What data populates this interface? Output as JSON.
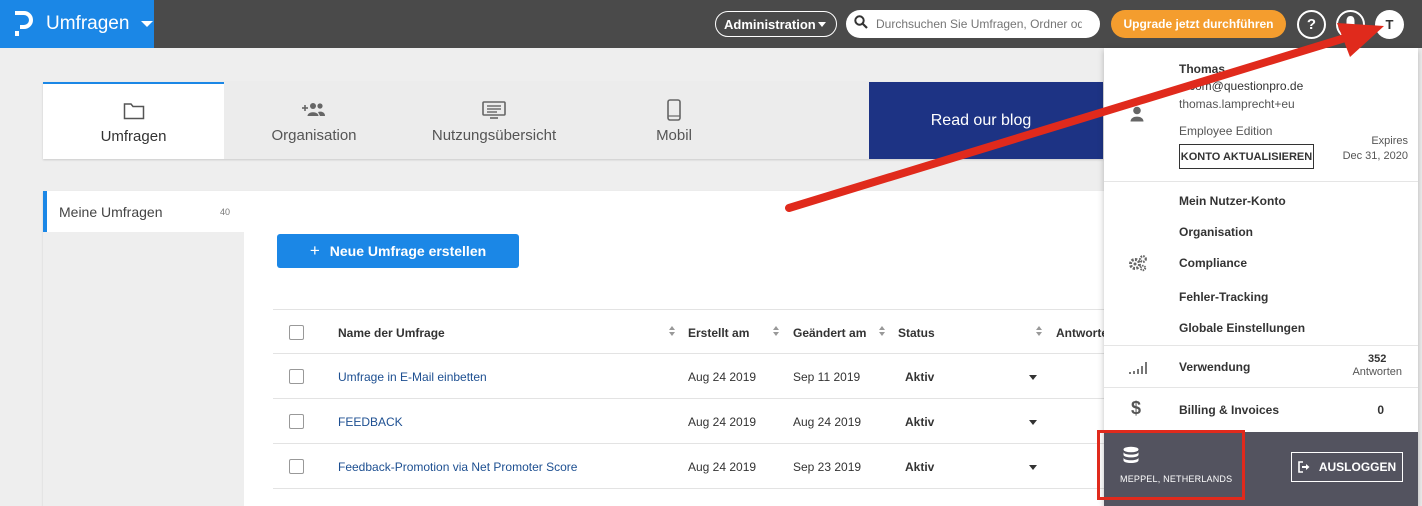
{
  "header": {
    "brand_title": "Umfragen",
    "admin_label": "Administration",
    "search_placeholder": "Durchsuchen Sie Umfragen, Ordner oder",
    "upgrade_label": "Upgrade jetzt durchführen",
    "help_label": "?",
    "avatar_initial": "T"
  },
  "tabs": [
    {
      "label": "Umfragen",
      "icon": "folder-icon"
    },
    {
      "label": "Organisation",
      "icon": "add-group-icon"
    },
    {
      "label": "Nutzungsübersicht",
      "icon": "monitor-icon"
    },
    {
      "label": "Mobil",
      "icon": "phone-icon"
    }
  ],
  "blog_label": "Read our blog",
  "folders": [
    {
      "label": "Meine Umfragen",
      "count": "40"
    }
  ],
  "new_survey_label": "Neue Umfrage erstellen",
  "table": {
    "headers": {
      "name": "Name der Umfrage",
      "created": "Erstellt am",
      "changed": "Geändert am",
      "status": "Status",
      "answers": "Antworte"
    },
    "rows": [
      {
        "name": "Umfrage in E-Mail einbetten",
        "created": "Aug 24 2019",
        "changed": "Sep 11 2019",
        "status": "Aktiv"
      },
      {
        "name": "FEEDBACK",
        "created": "Aug 24 2019",
        "changed": "Aug 24 2019",
        "status": "Aktiv"
      },
      {
        "name": "Feedback-Promotion via Net Promoter Score",
        "created": "Aug 24 2019",
        "changed": "Sep 23 2019",
        "status": "Aktiv"
      }
    ]
  },
  "account_menu": {
    "name": "Thomas",
    "email": "...com@questionpro.de",
    "username": "thomas.lamprecht+eu",
    "edition": "Employee Edition",
    "upgrade_account_label": "KONTO AKTUALISIEREN",
    "expires_label": "Expires",
    "expires_date": "Dec 31, 2020",
    "links": [
      "Mein Nutzer-Konto",
      "Organisation",
      "Compliance",
      "Fehler-Tracking",
      "Globale Einstellungen"
    ],
    "usage_label": "Verwendung",
    "usage_count": "352",
    "usage_unit": "Antworten",
    "billing_label": "Billing & Invoices",
    "billing_value": "0",
    "location": "MEPPEL, NETHERLANDS",
    "logout_label": "AUSLOGGEN"
  },
  "colors": {
    "brand_blue": "#1b87e6",
    "topbar": "#4a4a4a",
    "upgrade_orange": "#f49d2e",
    "blog_navy": "#1d3384",
    "annotation_red": "#e02a1c"
  }
}
